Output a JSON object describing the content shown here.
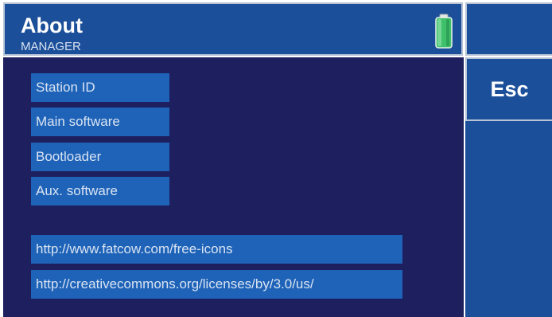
{
  "header": {
    "title": "About",
    "subtitle": "MANAGER",
    "battery_icon": "battery-icon"
  },
  "side": {
    "esc_label": "Esc"
  },
  "info_rows": [
    {
      "label": "Station ID",
      "value": "",
      "value2": ""
    },
    {
      "label": "Main software",
      "value": ""
    },
    {
      "label": "Bootloader",
      "value": ""
    },
    {
      "label": "Aux. software",
      "value": ""
    }
  ],
  "links": [
    "http://www.fatcow.com/free-icons",
    "http://creativecommons.org/licenses/by/3.0/us/"
  ],
  "colors": {
    "background": "#1e1f5e",
    "panel": "#1c4f9a",
    "cell": "#1e63b8",
    "battery": "#3fc06a"
  }
}
